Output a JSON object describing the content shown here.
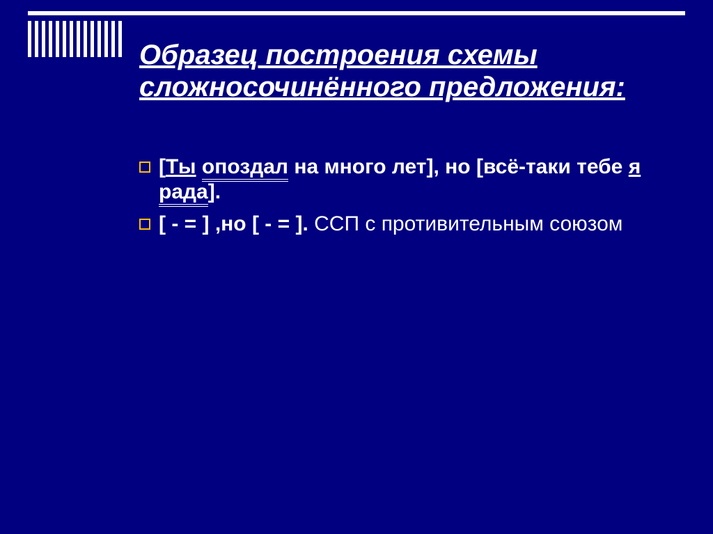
{
  "title": "Образец  построения схемы сложносочинённого предложения:",
  "items": [
    {
      "open1": "[",
      "subj1": "Ты",
      "sp1": " ",
      "pred1": "опоздал",
      "mid1": " на много лет], но [",
      "conj_tail": "всё-таки тебе ",
      "subj2": "я",
      "sp2": " ",
      "pred2": "рада",
      "close2": "]."
    },
    {
      "schema": "[ - =   ] ,но [ - =   ]. ",
      "type": "ССП с противительным союзом"
    }
  ]
}
